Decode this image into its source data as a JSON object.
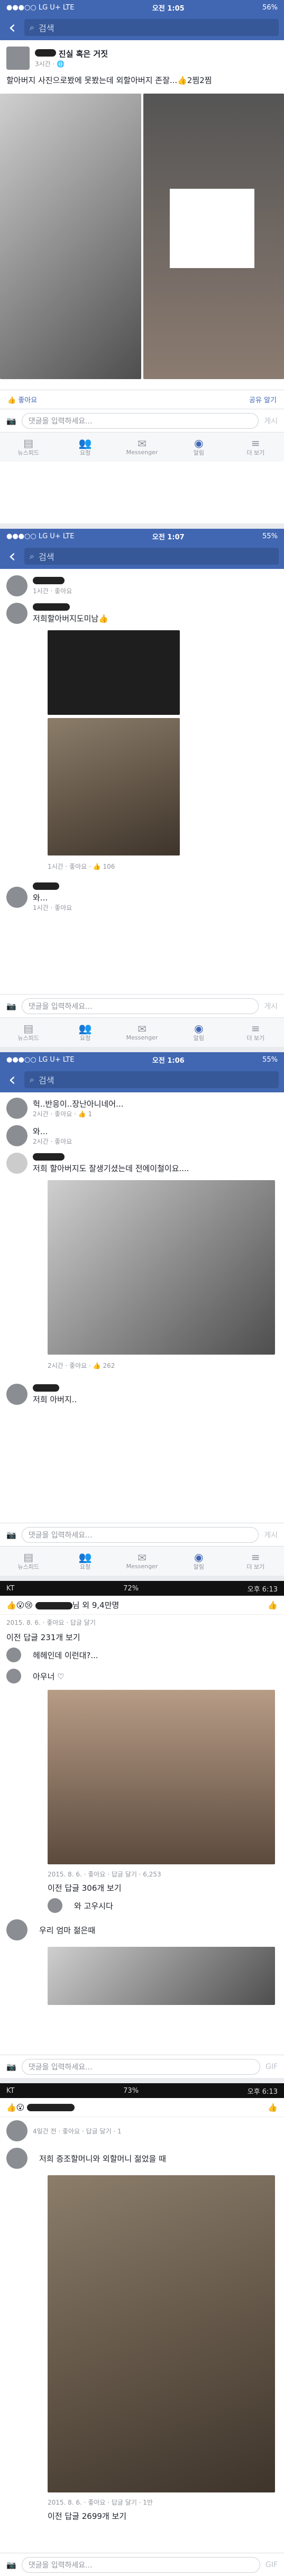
{
  "shot1": {
    "status": {
      "carrier": "●●●○○ LG U+ LTE",
      "time": "오전 1:05",
      "battery": "56%"
    },
    "search": "검색",
    "post_title": "진실 혹은 거짓",
    "post_meta": "3시간 · 🌐",
    "post_text": "할아버지 사진으로봤에 못봤는데 외할아버지 존잘...👍2찜2찜",
    "like_label": "좋아요",
    "share_label": "공유 알기",
    "comment_placeholder": "댓글을 입력하세요...",
    "post_button": "게시",
    "tabs": [
      "뉴스피드",
      "요청",
      "Messenger",
      "알림",
      "더 보기"
    ]
  },
  "shot2": {
    "status": {
      "carrier": "●●●○○ LG U+ LTE",
      "time": "오전 1:07",
      "battery": "55%"
    },
    "search": "검색",
    "c1_meta": "1시간 · 좋아요",
    "c2_text": "저희할아버지도미남👍",
    "c2_meta": "1시간 · 좋아요 · 👍 106",
    "c3_text": "와...",
    "c3_meta": "1시간 · 좋아요",
    "comment_placeholder": "댓글을 입력하세요...",
    "post_button": "게시",
    "tabs": [
      "뉴스피드",
      "요청",
      "Messenger",
      "알림",
      "더 보기"
    ]
  },
  "shot3": {
    "status": {
      "carrier": "●●●○○ LG U+ LTE",
      "time": "오전 1:06",
      "battery": "55%"
    },
    "search": "검색",
    "c1_text": "헉..반응이..장난아니네어...",
    "c1_meta": "2시간 · 좋아요 · 👍 1",
    "c2_text": "와...",
    "c2_meta": "2시간 · 좋아요",
    "c3_text": "저희 할아버지도 잘생기셨는데 전에이철이요....",
    "c3_meta": "2시간 · 좋아요 · 👍 262",
    "c4_text": "저희 아버지..",
    "comment_placeholder": "댓글을 입력하세요...",
    "post_button": "게시",
    "tabs": [
      "뉴스피드",
      "요청",
      "Messenger",
      "알림",
      "더 보기"
    ]
  },
  "shot4": {
    "status": {
      "carrier": "KT",
      "time": "오후 6:13",
      "battery": "72%"
    },
    "head": "님 외 9,4만명",
    "meta1": "2015. 8. 6. · 좋아요 · 답글 달기",
    "prev1": "이전 답글 231개 보기",
    "reply1": "헤헤인데 이런대?...",
    "reply2": "아우너 ♡",
    "meta2": "2015. 8. 6. · 좋아요 · 답글 달기 · 6,253",
    "prev2": "이전 답글 306개 보기",
    "reply3": "와 고우시다",
    "reply4": "우리 엄마 젊은때",
    "comment_placeholder": "댓글을 입력하세요...",
    "gif": "GIF"
  },
  "shot5": {
    "status": {
      "carrier": "KT",
      "time": "오후 6:13",
      "battery": "73%"
    },
    "meta1": "4일간 전 · 좋아요 · 답글 달기 · 1",
    "text": "저희 증조할머니와 외할머니 젊었을 때",
    "meta2": "2015. 8. 6. · 좋아요 · 답글 달기 · 1만",
    "prev": "이전 답글 2699개 보기",
    "comment_placeholder": "댓글을 입력하세요...",
    "gif": "GIF"
  }
}
